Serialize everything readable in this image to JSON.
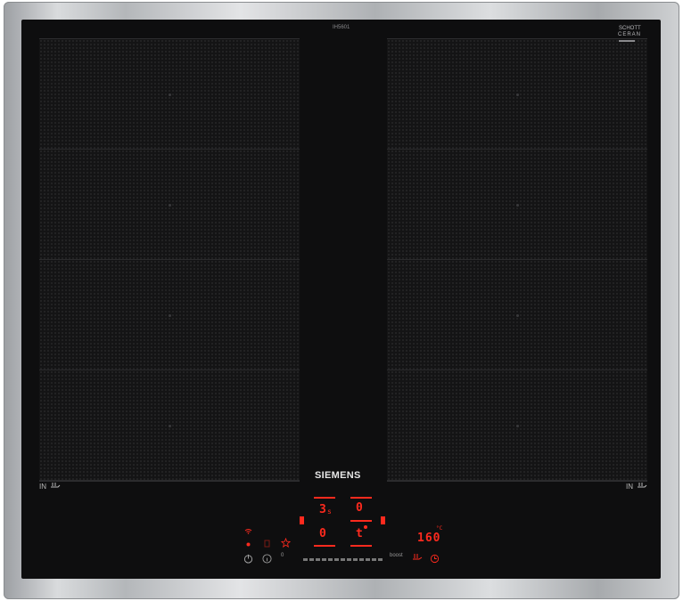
{
  "hob": {
    "brand": "SIEMENS",
    "maker_mark_line1": "SCHOTT",
    "maker_mark_line2": "CERAN",
    "center_top_mark": "IH5601"
  },
  "left_zone_label": "IN",
  "right_zone_label": "IN",
  "display": {
    "left_level": "3",
    "left_level_sub": "s",
    "right_level_top": "0",
    "left_level_bottom": "0",
    "right_level_bottom": "t",
    "temperature": "160",
    "temperature_unit": "°C"
  },
  "slider": {
    "min_label": "0",
    "max_label": "boost"
  },
  "colors": {
    "display_red": "#ff2a1e",
    "glass": "#0e0e0f",
    "frame": "#c8cacc"
  }
}
